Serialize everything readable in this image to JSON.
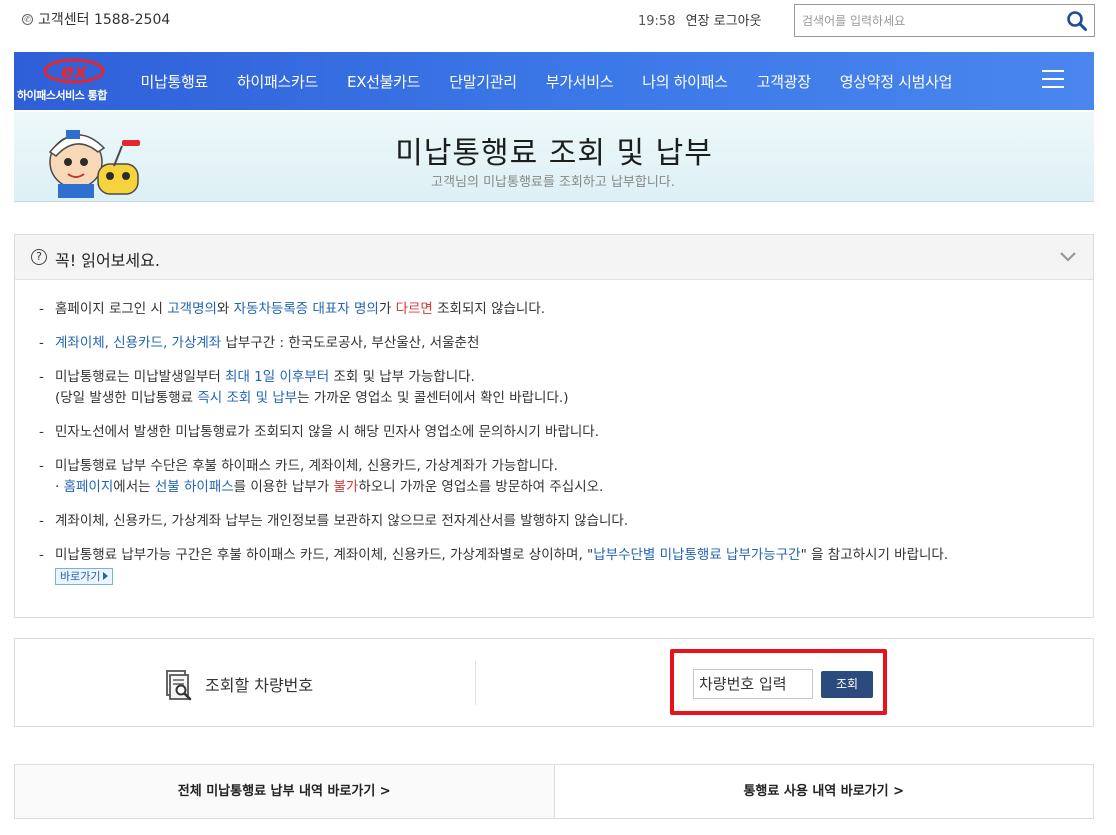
{
  "header": {
    "customer_center": "고객센터 1588-2504",
    "time": "19:58",
    "extend": "연장",
    "logout": "로그아웃",
    "search_placeholder": "검색어를 입력하세요"
  },
  "logo": {
    "mark": "ex",
    "text": "하이패스서비스 통합"
  },
  "nav": {
    "items": [
      "미납통행료",
      "하이패스카드",
      "EX선불카드",
      "단말기관리",
      "부가서비스",
      "나의 하이패스",
      "고객광장",
      "영상약정 시범사업"
    ]
  },
  "banner": {
    "title": "미납통행료 조회 및 납부",
    "subtitle": "고객님의 미납통행료를 조회하고 납부합니다."
  },
  "notice": {
    "title": "꼭! 읽어보세요.",
    "items": {
      "i1": {
        "a": "홈페이지 로그인 시 ",
        "b": "고객명의",
        "c": "와 ",
        "d": "자동차등록증 대표자 명의",
        "e": "가 ",
        "f": "다르면",
        "g": " 조회되지 않습니다."
      },
      "i2": {
        "a": "계좌이체, 신용카드, 가상계좌",
        "b": " 납부구간 : 한국도로공사, 부산울산, 서울춘천"
      },
      "i3": {
        "a": "미납통행료는 미납발생일부터 ",
        "b": "최대 1일 이후부터",
        "c": " 조회 및 납부 가능합니다.",
        "d": "(당일 발생한 미납통행료 ",
        "e": "즉시 조회 및 납부",
        "f": "는 가까운 영업소 및 콜센터에서 확인 바랍니다.)"
      },
      "i4": {
        "a": "민자노선에서 발생한 미납통행료가 조회되지 않을 시 해당 민자사 영업소에 문의하시기 바랍니다."
      },
      "i5": {
        "a": "미납통행료 납부 수단은 후불 하이패스 카드, 계좌이체, 신용카드, 가상계좌가 가능합니다.",
        "b": "· ",
        "c": "홈페이지",
        "d": "에서는 ",
        "e": "선불 하이패스",
        "f": "를 이용한 납부가 ",
        "g": "불가",
        "h": "하오니 가까운 영업소를 방문하여 주십시오."
      },
      "i6": {
        "a": "계좌이체, 신용카드, 가상계좌 납부는 개인정보를 보관하지 않으므로 전자계산서를 발행하지 않습니다."
      },
      "i7": {
        "a": "미납통행료 납부가능 구간은 후불 하이패스 카드, 계좌이체, 신용카드, 가상계좌별로 상이하며, \"",
        "b": "납부수단별 미납통행료 납부가능구간",
        "c": "\" 을 참고하시기 바랍니다.",
        "go": "바로가기"
      }
    }
  },
  "vehicle": {
    "label": "조회할 차량번호",
    "input_value": "",
    "input_placeholder": "차량번호 입력",
    "button": "조회"
  },
  "bottom_links": [
    "전체 미납통행료 납부 내역 바로가기 >",
    "통행료 사용 내역 바로가기 >"
  ],
  "colors": {
    "nav": "#3c79e8",
    "highlight_box": "#e8131a",
    "link": "#2265b5",
    "warning": "#d23a3a",
    "button": "#2b4b7e"
  }
}
